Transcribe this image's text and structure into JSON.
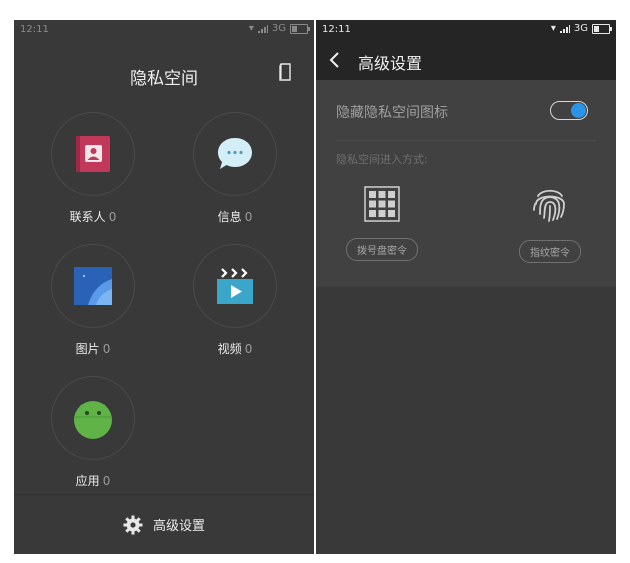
{
  "left_screen": {
    "status": {
      "time": "12:11",
      "network": "3G"
    },
    "title": "隐私空间",
    "apps": [
      {
        "label": "联系人",
        "count": "0"
      },
      {
        "label": "信息",
        "count": "0"
      },
      {
        "label": "图片",
        "count": "0"
      },
      {
        "label": "视频",
        "count": "0"
      },
      {
        "label": "应用",
        "count": "0"
      }
    ],
    "bottom_label": "高级设置"
  },
  "right_screen": {
    "status": {
      "time": "12:11",
      "network": "3G"
    },
    "title": "高级设置",
    "hide_icon_label": "隐藏隐私空间图标",
    "hide_icon_enabled": true,
    "entry_label": "隐私空间进入方式:",
    "methods": [
      {
        "label": "拨号盘密令"
      },
      {
        "label": "指纹密令"
      }
    ]
  },
  "colors": {
    "background": "#393939",
    "header": "#252525",
    "panel": "#414141",
    "toggle_accent": "#2a95e8"
  }
}
